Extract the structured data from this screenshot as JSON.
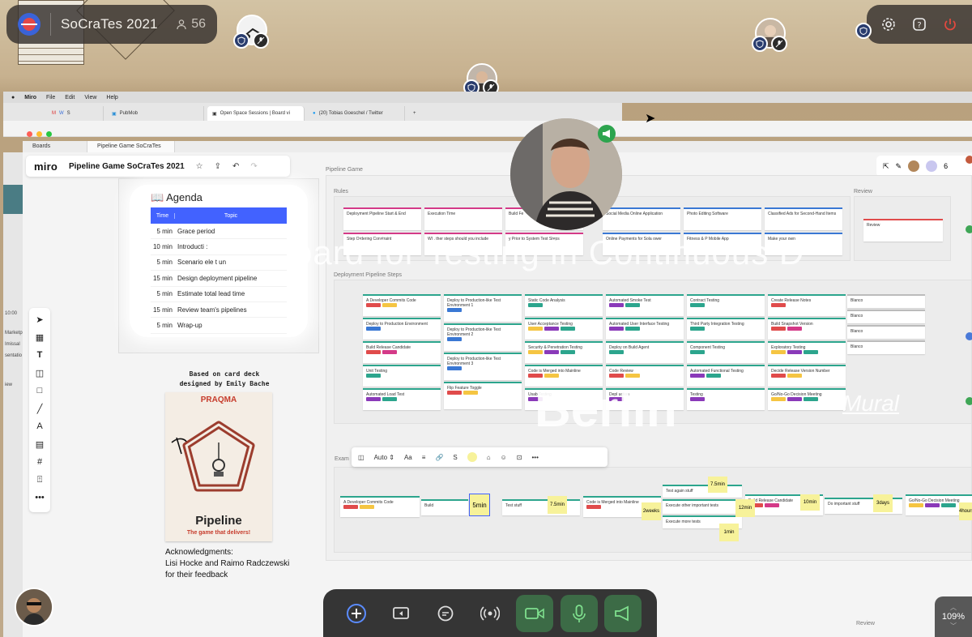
{
  "space": {
    "name": "SoCraTes 2021",
    "user_count": "56"
  },
  "mac_menu": {
    "app": "Miro",
    "items": [
      "File",
      "Edit",
      "View",
      "Help"
    ]
  },
  "browser": {
    "tabs": [
      {
        "label": "",
        "icon": "gmail-icon"
      },
      {
        "label": "PubMob"
      },
      {
        "label": "Open Space Sessions | Board vi"
      },
      {
        "label": "(20) Tobias Goeschel / Twitter"
      }
    ]
  },
  "app_tabs": [
    "Boards",
    "Pipeline Game SoCraTes ..."
  ],
  "miro": {
    "logo": "miro",
    "board_title": "Pipeline Game SoCraTes 2021",
    "collaborators": "6"
  },
  "left_strip": {
    "lines": [
      "10:00",
      "Marketp",
      "Imissal",
      "sentatio",
      "iew"
    ]
  },
  "agenda": {
    "title": "📖 Agenda",
    "col_time": "Time",
    "col_topic": "Topic",
    "rows": [
      {
        "time": "5 min",
        "topic": "Grace period"
      },
      {
        "time": "10 min",
        "topic": "Introducti :"
      },
      {
        "time": "5 min",
        "topic": "Scenario ele t un"
      },
      {
        "time": "15 min",
        "topic": "Design deployment pipeline"
      },
      {
        "time": "5 min",
        "topic": "Estimate total lead time"
      },
      {
        "time": "15 min",
        "topic": "Review team's pipelines"
      },
      {
        "time": "5 min",
        "topic": "Wrap-up"
      }
    ]
  },
  "credits": {
    "based_on": "Based on card deck",
    "designed_by": "designed by Emily Bache",
    "card_brand": "PRAQMA",
    "card_title": "Pipeline",
    "card_tagline": "The game that delivers!",
    "ack_1": "Acknowledgments:",
    "ack_2": "Lisi Hocke and Raimo Radczewski",
    "ack_3": "for their feedback"
  },
  "frames": {
    "pipeline_game": "Pipeline Game",
    "rules": "Rules",
    "review_top": "Review",
    "steps": "Deployment Pipeline Steps",
    "example": "Exam",
    "review_bottom": "Review"
  },
  "rules_cards": [
    "Deployment Pipeline Start & End",
    "Execution Time",
    "Build Fe",
    "Step Ordering Constraint",
    "WI . ther steps should you include",
    "y Prior to System Test Steps",
    "Social Media Online Application",
    "Photo Editing Software",
    "Classified Ads for Second-Hand Items",
    "Online Payments for Sola    ower",
    "Fitness & P      Mobile App",
    "Make your own"
  ],
  "review_card": "Review",
  "steps_cols": [
    [
      "A Developer Commits Code",
      "Deploy to Production Environment",
      "Build Release Candidate",
      "Unit Testing",
      "Automated Load Test"
    ],
    [
      "Deploy to Production-like Test Environment 1",
      "Deploy to Production-like Test Environment 2",
      "Deploy to Production-like Test Environment 3",
      "Flip Feature Toggle"
    ],
    [
      "Static Code Analysis",
      "User Acceptance Testing",
      "Security & Penetration Testing",
      "Code is Merged into Mainline",
      "Usab        Testing"
    ],
    [
      "Automated Smoke Test",
      "Automated User Interface Testing",
      "Deploy on Build Agent",
      "Code Review",
      "Depl          uction"
    ],
    [
      "Contract Testing",
      "Third Party Integration Testing",
      "Component Testing",
      "Automated Functional Testing",
      "          Testing"
    ],
    [
      "Create Release Notes",
      "Build Snapshot Version",
      "Exploratory Testing",
      "Decide Release Version Number",
      "Go/No-Go Decision Meeting"
    ],
    [
      "Blanco",
      "Blanco",
      "Blanco",
      "Blanco"
    ]
  ],
  "watermark": "oard for Testing in Continuous D",
  "berlin": "Berlin",
  "mural": "Mural",
  "example": {
    "cards": [
      "A Developer Commits Code",
      "Build",
      "Test stuff",
      "Code is Merged into Mainline",
      "Test again stuff",
      "Execute other important tests",
      "Execute more tests",
      "Build Release Candidate",
      "Do important stuff",
      "Go/No-Go Decision Meeting"
    ],
    "times": [
      "5min",
      "7.5min",
      "2weeks",
      "7.5min",
      "12min",
      "1min",
      "10min",
      "3days",
      "4hours"
    ]
  },
  "ctx_bar": {
    "font": "Auto",
    "font_size_label": "Aa",
    "size": "S"
  },
  "zoom": "109%"
}
